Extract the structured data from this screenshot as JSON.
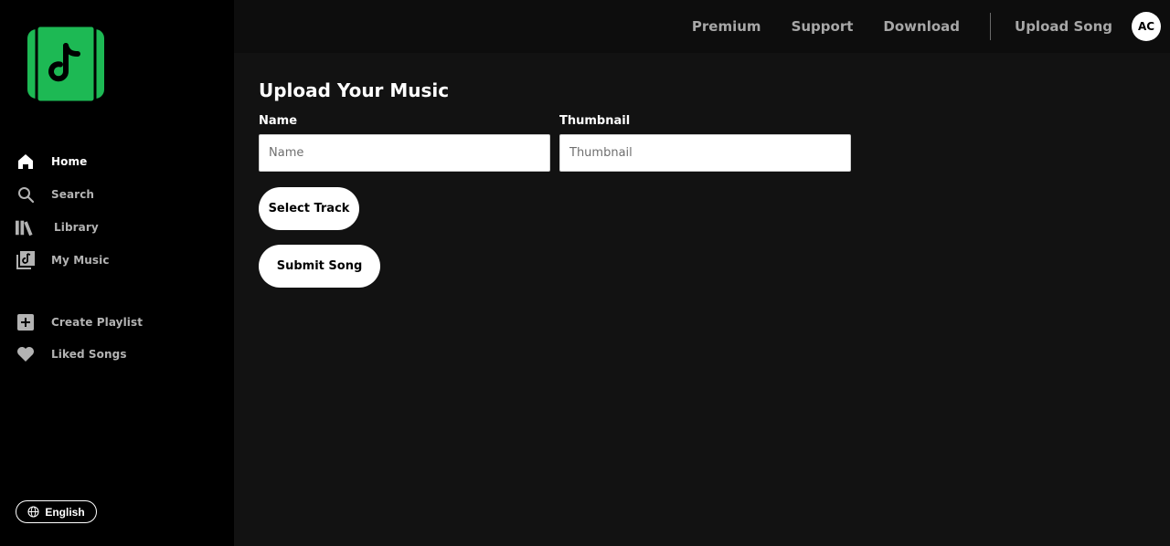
{
  "sidebar": {
    "nav": [
      {
        "label": "Home",
        "icon": "home-icon"
      },
      {
        "label": "Search",
        "icon": "search-icon"
      },
      {
        "label": "Library",
        "icon": "library-icon"
      },
      {
        "label": "My Music",
        "icon": "my-music-icon"
      }
    ],
    "secondary": [
      {
        "label": "Create Playlist",
        "icon": "plus-square-icon"
      },
      {
        "label": "Liked Songs",
        "icon": "heart-icon"
      }
    ],
    "language": "English"
  },
  "topbar": {
    "premium": "Premium",
    "support": "Support",
    "download": "Download",
    "upload": "Upload Song",
    "avatar_initials": "AC"
  },
  "main": {
    "title": "Upload Your Music",
    "name_label": "Name",
    "name_placeholder": "Name",
    "thumbnail_label": "Thumbnail",
    "thumbnail_placeholder": "Thumbnail",
    "select_track": "Select Track",
    "submit_song": "Submit Song"
  },
  "colors": {
    "brand_green": "#1db954",
    "sidebar_bg": "#000000",
    "main_bg": "#121212"
  }
}
